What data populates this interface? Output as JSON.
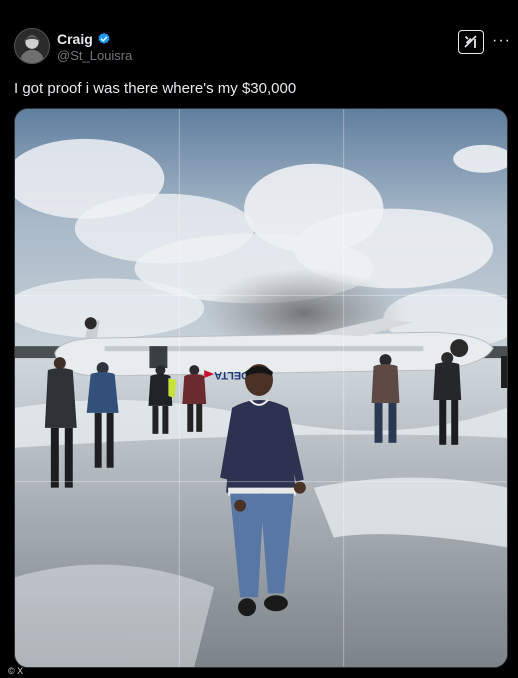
{
  "author": {
    "display_name": "Craig",
    "handle": "@St_Louisra",
    "verified_color": "#1d9bf0"
  },
  "actions": {
    "grok_icon": "grok-icon",
    "more_icon": "more-horizontal-icon",
    "more_label": "···"
  },
  "tweet": {
    "text": "I got proof i was there where's my $30,000"
  },
  "media": {
    "aircraft_livery": "DELTA",
    "kind": "photo"
  },
  "footer": {
    "credit": "© X"
  }
}
